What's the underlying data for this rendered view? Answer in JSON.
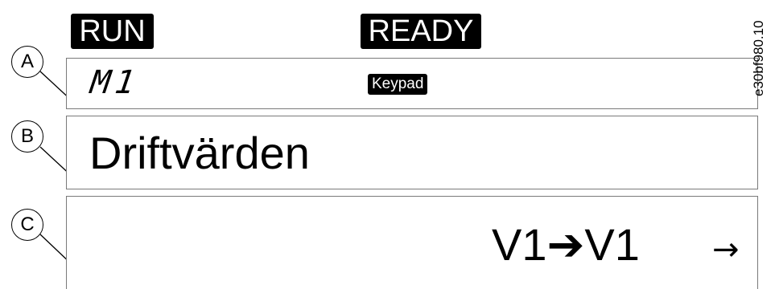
{
  "status": {
    "run_label": "RUN",
    "ready_label": "READY"
  },
  "panel_a": {
    "menu_code": "M1",
    "control_place": "Keypad"
  },
  "panel_b": {
    "title": "Driftvärden"
  },
  "panel_c": {
    "path_from": "V1",
    "path_to": "V1",
    "path_arrow_icon": "heavy-right-arrow-icon",
    "nav_arrow_icon": "right-arrow-icon"
  },
  "callouts": {
    "a": "A",
    "b": "B",
    "c": "C"
  },
  "figure_id": "e30bf980.10"
}
